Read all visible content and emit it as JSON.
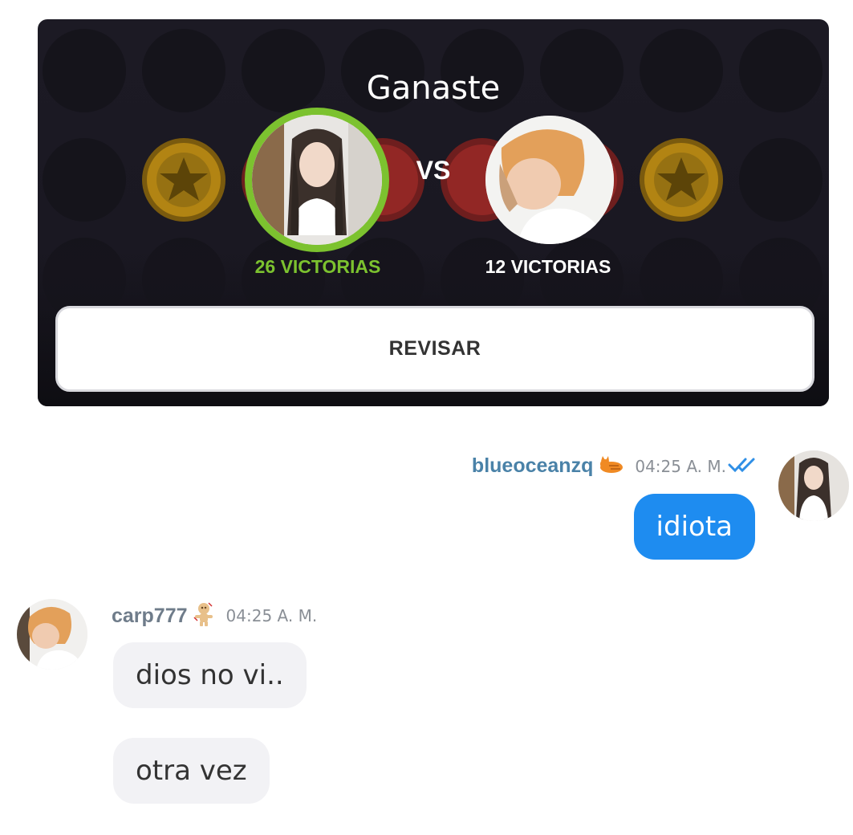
{
  "game": {
    "result_title": "Ganaste",
    "vs_label": "VS",
    "player_you": {
      "wins_label": "26 VICTORIAS",
      "ring_color": "#7cc22f"
    },
    "player_opponent": {
      "wins_label": "12 VICTORIAS"
    },
    "review_button_label": "REVISAR",
    "colors": {
      "background": "#1c1a24",
      "winner_green": "#7cc22f",
      "red_piece": "#c0392b",
      "yellow_piece": "#e6b21a"
    }
  },
  "chat": {
    "messages": [
      {
        "username": "blueoceanzq",
        "badge_icon": "cat-emoji-icon",
        "time": "04:25 A. M.",
        "status_icon": "double-check-icon",
        "text": "idiota"
      },
      {
        "username": "carp777",
        "badge_icon": "voodoo-doll-icon",
        "time": "04:25 A. M.",
        "text": "dios no vi.."
      },
      {
        "text": "otra vez"
      }
    ],
    "colors": {
      "outgoing_bubble": "#1e8cf0",
      "incoming_bubble": "#f2f2f5",
      "self_username": "#4a82a8"
    }
  }
}
